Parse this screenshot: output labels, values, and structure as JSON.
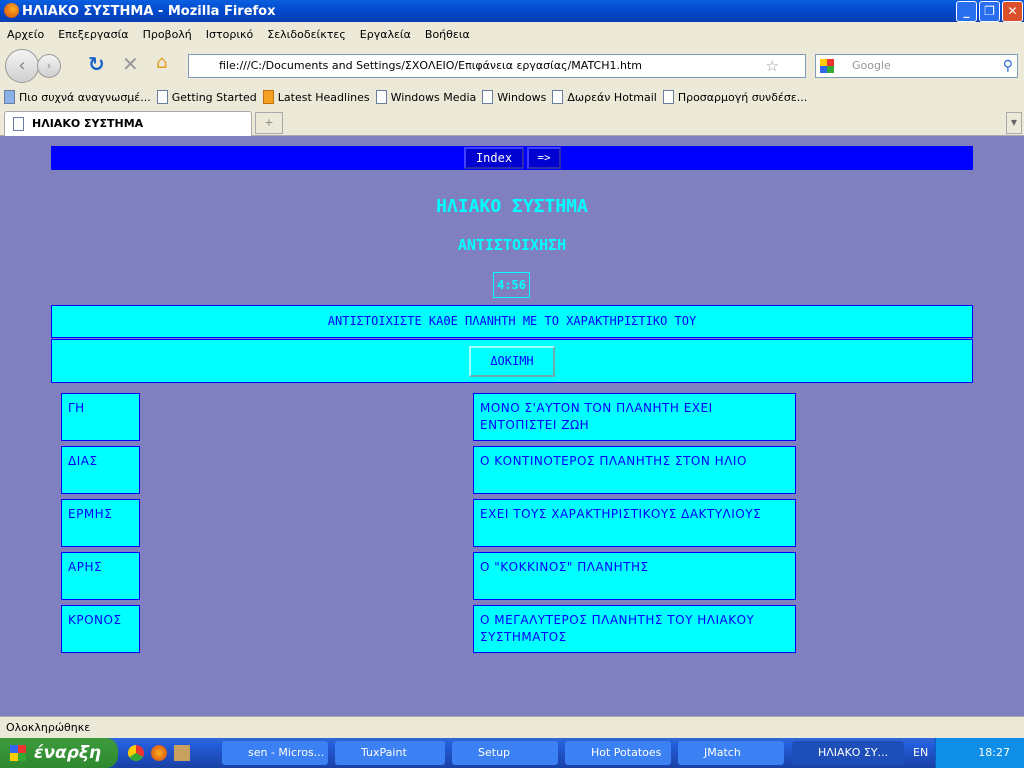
{
  "window": {
    "title": "ΗΛΙΑΚΟ ΣΥΣΤΗΜΑ - Mozilla Firefox"
  },
  "menu": [
    "Αρχείο",
    "Επεξεργασία",
    "Προβολή",
    "Ιστορικό",
    "Σελιδοδείκτες",
    "Εργαλεία",
    "Βοήθεια"
  ],
  "nav": {
    "url": "file:///C:/Documents and Settings/ΣΧΟΛΕΙΟ/Επιφάνεια εργασίας/MATCH1.htm",
    "search_placeholder": "Google"
  },
  "bookmarks": [
    "Πιο συχνά αναγνωσμέ...",
    "Getting Started",
    "Latest Headlines",
    "Windows Media",
    "Windows",
    "Δωρεάν Hotmail",
    "Προσαρμογή συνδέσε..."
  ],
  "tab": {
    "label": "ΗΛΙΑΚΟ ΣΥΣΤΗΜΑ"
  },
  "page": {
    "nav_index": "Index",
    "nav_next": "=>",
    "title": "ΗΛΙΑΚΟ ΣΥΣΤΗΜΑ",
    "subtitle": "ΑΝΤΙΣΤΟΙΧΗΣΗ",
    "timer": "4:56",
    "instructions": "ΑΝΤΙΣΤΟΙΧΙΣΤΕ ΚΑΘΕ ΠΛΑΝΗΤΗ ΜΕ ΤΟ ΧΑΡΑΚΤΗΡΙΣΤΙΚΟ ΤΟΥ",
    "check_button": "ΔΟΚΙΜΗ",
    "left_items": [
      "ΓΗ",
      "ΔΙΑΣ",
      "ΕΡΜΗΣ",
      "ΑΡΗΣ",
      "ΚΡΟΝΟΣ"
    ],
    "right_items": [
      "ΜΟΝΟ Σ'ΑΥΤΟΝ ΤΟΝ ΠΛΑΝΗΤΗ ΕΧΕΙ ΕΝΤΟΠΙΣΤΕΙ ΖΩΗ",
      "Ο ΚΟΝΤΙΝΟΤΕΡΟΣ ΠΛΑΝΗΤΗΣ ΣΤΟΝ ΗΛΙΟ",
      "ΕΧΕΙ ΤΟΥΣ ΧΑΡΑΚΤΗΡΙΣΤΙΚΟΥΣ ΔΑΚΤΥΛΙΟΥΣ",
      "Ο \"ΚΟΚΚΙΝΟΣ\" ΠΛΑΝΗΤΗΣ",
      "Ο ΜΕΓΑΛΥΤΕΡΟΣ ΠΛΑΝΗΤΗΣ ΤΟΥ ΗΛΙΑΚΟΥ ΣΥΣΤΗΜΑΤΟΣ"
    ]
  },
  "status": "Ολοκληρώθηκε",
  "taskbar": {
    "start": "έναρξη",
    "tasks": [
      "sen - Micros...",
      "TuxPaint",
      "Setup",
      "Hot Potatoes",
      "JMatch",
      "ΗΛΙΑΚΟ ΣΥ..."
    ],
    "lang": "EN",
    "clock": "18:27"
  },
  "colors": {
    "page_bg": "#8080c0",
    "box": "#00ffff",
    "text": "#0000ff",
    "navbar": "#0000ff"
  }
}
